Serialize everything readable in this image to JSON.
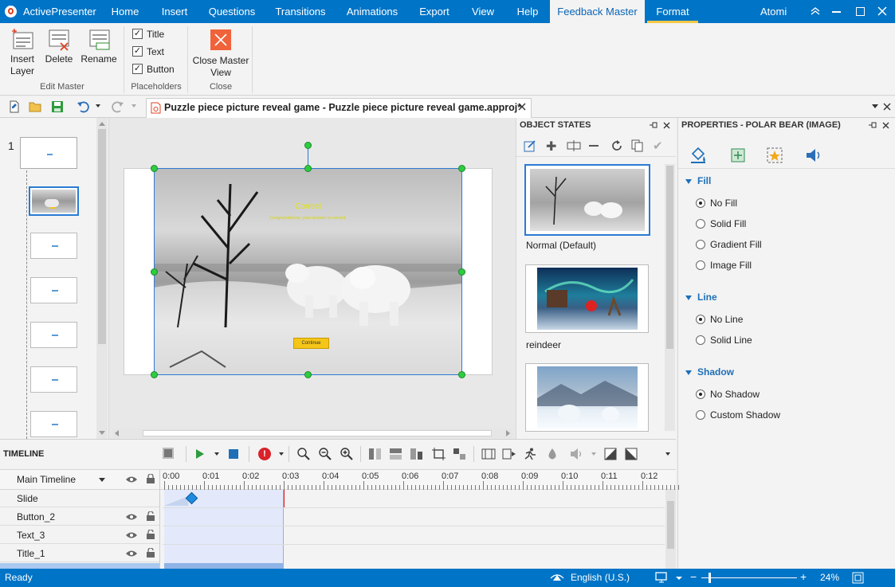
{
  "app": {
    "name": "ActivePresenter",
    "user": "Atomi"
  },
  "menu_tabs": [
    "Home",
    "Insert",
    "Questions",
    "Transitions",
    "Animations",
    "Export",
    "View",
    "Help",
    "Feedback Master",
    "Format"
  ],
  "ribbon": {
    "insert_layer": "Insert\nLayer",
    "delete": "Delete",
    "rename": "Rename",
    "group_edit_master": "Edit Master",
    "placeholders": [
      {
        "label": "Title",
        "checked": true
      },
      {
        "label": "Text",
        "checked": true
      },
      {
        "label": "Button",
        "checked": true
      }
    ],
    "group_placeholders": "Placeholders",
    "close_master_view": "Close Master\nView",
    "group_close": "Close"
  },
  "document": {
    "tab_title": "Puzzle piece picture reveal game - Puzzle piece picture reveal game.approj*"
  },
  "slides": {
    "number": "1"
  },
  "slide": {
    "correct_title": "Correct",
    "correct_text": "Congratulations, your answer is correct.",
    "button_label": "Continue"
  },
  "object_states": {
    "title": "OBJECT STATES",
    "states": [
      {
        "label": "Normal (Default)"
      },
      {
        "label": "reindeer"
      },
      {
        "label": ""
      }
    ]
  },
  "properties": {
    "title": "PROPERTIES - POLAR BEAR (IMAGE)",
    "fill": {
      "title": "Fill",
      "options": [
        "No Fill",
        "Solid Fill",
        "Gradient Fill",
        "Image Fill"
      ],
      "selected": "No Fill"
    },
    "line": {
      "title": "Line",
      "options": [
        "No Line",
        "Solid Line"
      ],
      "selected": "No Line"
    },
    "shadow": {
      "title": "Shadow",
      "options": [
        "No Shadow",
        "Custom Shadow"
      ],
      "selected": "No Shadow"
    }
  },
  "timeline": {
    "title": "TIMELINE",
    "main_timeline": "Main Timeline",
    "ticks": [
      "0:00",
      "0:01",
      "0:02",
      "0:03",
      "0:04",
      "0:05",
      "0:06",
      "0:07",
      "0:08",
      "0:09",
      "0:10",
      "0:11",
      "0:12"
    ],
    "rows": [
      "Slide",
      "Button_2",
      "Text_3",
      "Title_1"
    ]
  },
  "status": {
    "text": "Ready",
    "language": "English (U.S.)",
    "zoom": "24%"
  },
  "colors": {
    "accent": "#0074c6",
    "selection": "#1e6fb8",
    "handle": "#2ecc40",
    "button": "#f5c518"
  }
}
